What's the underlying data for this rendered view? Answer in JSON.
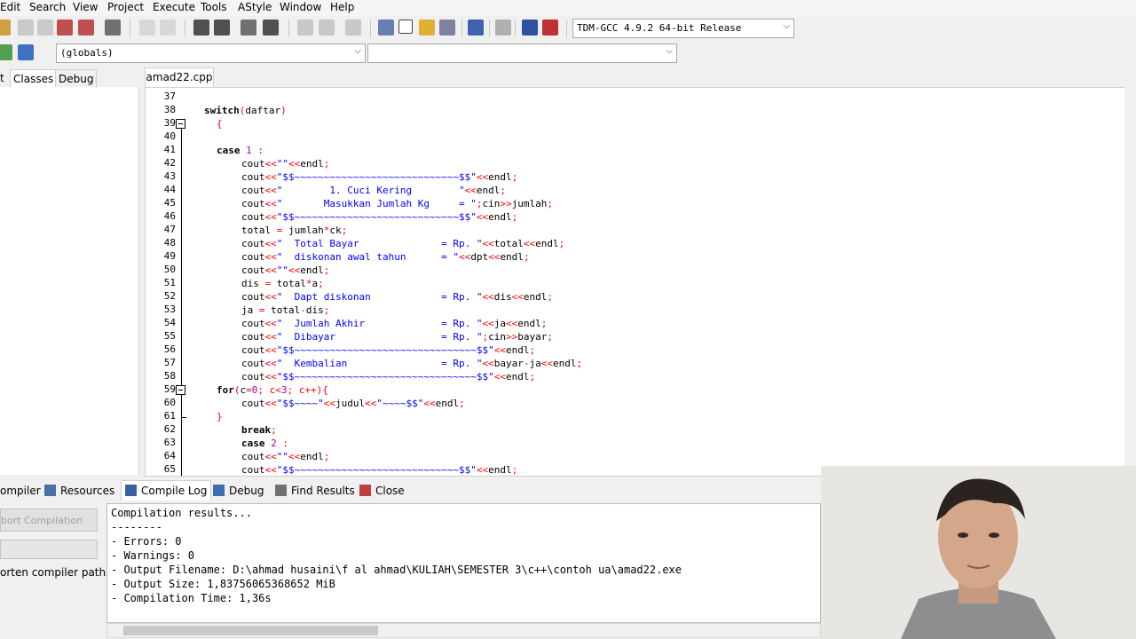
{
  "menu": [
    "Edit",
    "Search",
    "View",
    "Project",
    "Execute",
    "Tools",
    "AStyle",
    "Window",
    "Help"
  ],
  "compiler_select": "TDM-GCC 4.9.2 64-bit Release",
  "scope_select": "(globals)",
  "left_tabs": [
    "t",
    "Classes",
    "Debug"
  ],
  "editor_tab": "amad22.cpp",
  "line_numbers": [
    "37",
    "38",
    "39",
    "40",
    "41",
    "42",
    "43",
    "44",
    "45",
    "46",
    "47",
    "48",
    "49",
    "50",
    "51",
    "52",
    "53",
    "54",
    "55",
    "56",
    "57",
    "58",
    "59",
    "60",
    "61",
    "62",
    "63",
    "64",
    "65"
  ],
  "bottom_tabs": [
    "ompiler",
    "Resources",
    "Compile Log",
    "Debug",
    "Find Results",
    "Close"
  ],
  "abort_label": "bort Compilation",
  "shorten_label": "orten compiler paths",
  "log_lines": [
    "Compilation results...",
    "--------",
    "- Errors: 0",
    "- Warnings: 0",
    "- Output Filename: D:\\ahmad husaini\\f al ahmad\\KULIAH\\SEMESTER 3\\c++\\contoh ua\\amad22.exe",
    "- Output Size: 1,83756065368652 MiB",
    "- Compilation Time: 1,36s"
  ],
  "code": {
    "l38_a": "switch",
    "l38_b": "(",
    "l38_c": "daftar",
    "l38_d": ")",
    "l39": "{",
    "l41_a": "case ",
    "l41_b": "1",
    "l41_c": " :",
    "l42_a": "cout",
    "l42_b": "<<",
    "l42_c": "\"\"",
    "l42_d": "<<",
    "l42_e": "endl",
    "l42_f": ";",
    "l43_s": "\"$$~~~~~~~~~~~~~~~~~~~~~~~~~~~~$$\"",
    "l44_s": "\"        1. Cuci Kering        \"",
    "l45_s": "\"       Masukkan Jumlah Kg     = \"",
    "l45_t": "jumlah",
    "l47_a": "total ",
    "l47_b": "=",
    "l47_c": " jumlah",
    "l47_d": "*",
    "l47_e": "ck",
    "l47_f": ";",
    "l48_s": "\"  Total Bayar              = Rp. \"",
    "l48_v": "total",
    "l49_s": "\"  diskonan awal tahun      = \"",
    "l49_v": "dpt",
    "l51_a": "dis ",
    "l51_b": "=",
    "l51_c": " total",
    "l51_d": "*",
    "l51_e": "a",
    "l51_f": ";",
    "l52_s": "\"  Dapt diskonan            = Rp. \"",
    "l52_v": "dis",
    "l53_a": "ja ",
    "l53_b": "=",
    "l53_c": " total",
    "l53_d": "-",
    "l53_e": "dis",
    "l53_f": ";",
    "l54_s": "\"  Jumlah Akhir             = Rp. \"",
    "l54_v": "ja",
    "l55_s": "\"  Dibayar                  = Rp. \"",
    "l55_v": "bayar",
    "l56_s": "\"$$~~~~~~~~~~~~~~~~~~~~~~~~~~~~~~~$$\"",
    "l57_s": "\"  Kembalian                = Rp. \"",
    "l57_v": "bayar",
    "l57_w": "ja",
    "l58_s": "\"$$~~~~~~~~~~~~~~~~~~~~~~~~~~~~~~~$$\"",
    "l59_a": "for",
    "l59_b": "(",
    "l59_c": "c",
    "l59_d": "=",
    "l59_e": "0",
    "l59_f": "; c",
    "l59_g": "<",
    "l59_h": "3",
    "l59_i": "; c",
    "l59_j": "++",
    "l59_k": "){",
    "l60_s1": "\"$$~~~~\"",
    "l60_v": "judul",
    "l60_s2": "\"~~~~$$\"",
    "l61": "}",
    "l62_a": "break",
    "l62_b": ";",
    "l63_a": "case ",
    "l63_b": "2",
    "l63_c": " :",
    "l65_s": "\"$$~~~~~~~~~~~~~~~~~~~~~~~~~~~~$$\""
  }
}
